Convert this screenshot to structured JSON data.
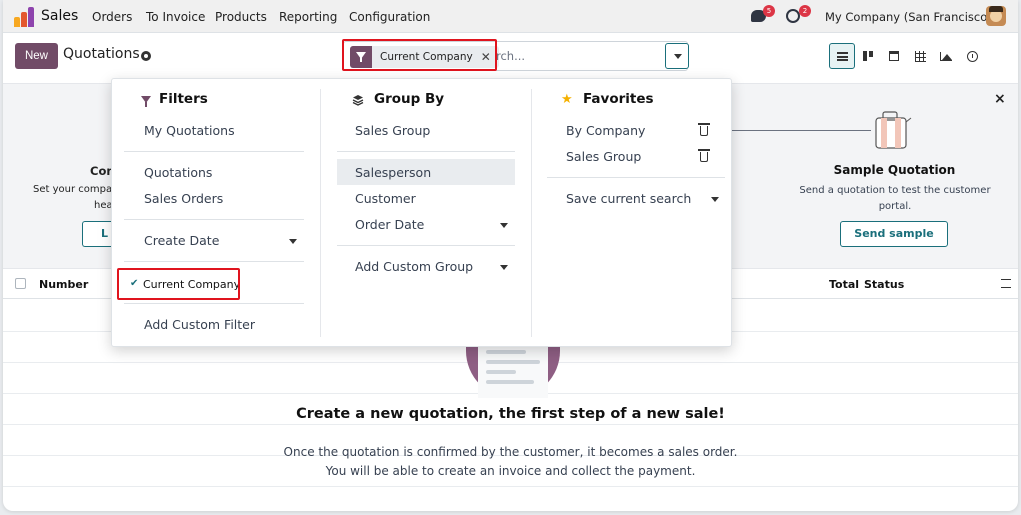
{
  "topnav": {
    "app_name": "Sales",
    "menus": [
      "Orders",
      "To Invoice",
      "Products",
      "Reporting",
      "Configuration"
    ],
    "messages_badge": "5",
    "activities_badge": "2",
    "company": "My Company (San Francisco)"
  },
  "control": {
    "new_label": "New",
    "breadcrumb": "Quotations",
    "search_placeholder": "Search...",
    "search_placeholder_visible": "rch...",
    "facet_label": "Current Company"
  },
  "helper": {
    "left_title": "Com",
    "left_desc_1": "Set your compa",
    "left_desc_2": "hea",
    "left_btn": "L",
    "sample_title": "Sample Quotation",
    "sample_desc": "Send a quotation to test the customer portal.",
    "sample_btn": "Send sample",
    "close": "×"
  },
  "table": {
    "col_number": "Number",
    "col_total": "Total",
    "col_status": "Status"
  },
  "empty": {
    "title": "Create a new quotation, the first step of a new sale!",
    "line1": "Once the quotation is confirmed by the customer, it becomes a sales order.",
    "line2": "You will be able to create an invoice and collect the payment."
  },
  "filters": {
    "title": "Filters",
    "my_quotations": "My Quotations",
    "quotations": "Quotations",
    "sales_orders": "Sales Orders",
    "create_date": "Create Date",
    "current_company": "Current Company",
    "add_custom_filter": "Add Custom Filter"
  },
  "groupby": {
    "title": "Group By",
    "sales_group": "Sales Group",
    "salesperson": "Salesperson",
    "customer": "Customer",
    "order_date": "Order Date",
    "add_custom_group": "Add Custom Group"
  },
  "favorites": {
    "title": "Favorites",
    "by_company": "By Company",
    "sales_group": "Sales Group",
    "save_current_search": "Save current search"
  },
  "colors": {
    "brand": "#714b67",
    "teal": "#1a6f7b",
    "highlight_red": "#e0141e"
  }
}
